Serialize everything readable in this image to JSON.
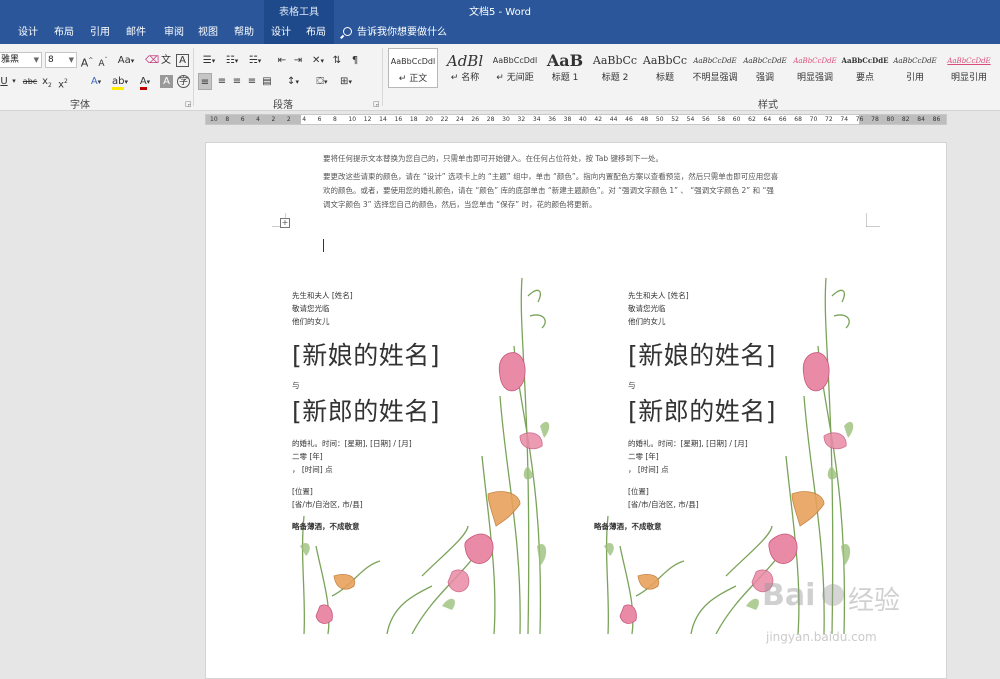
{
  "window": {
    "doc_title": "文档5 - Word",
    "context_group": "表格工具"
  },
  "tabs": [
    {
      "label": "设计"
    },
    {
      "label": "布局"
    },
    {
      "label": "引用"
    },
    {
      "label": "邮件"
    },
    {
      "label": "审阅"
    },
    {
      "label": "视图"
    },
    {
      "label": "帮助"
    },
    {
      "label": "设计"
    },
    {
      "label": "布局"
    }
  ],
  "tell_me": "告诉我你想要做什么",
  "font": {
    "name": "雅黑",
    "size": "8",
    "group_label": "字体"
  },
  "paragraph": {
    "group_label": "段落"
  },
  "styles": {
    "group_label": "样式",
    "items": [
      {
        "sample": "AaBbCcDdl",
        "name": "↵ 正文"
      },
      {
        "sample": "AdBl",
        "name": "↵ 名称"
      },
      {
        "sample": "AaBbCcDdl",
        "name": "↵ 无间距"
      },
      {
        "sample": "AaB",
        "name": "标题 1"
      },
      {
        "sample": "AaBbCc",
        "name": "标题 2"
      },
      {
        "sample": "AaBbCc",
        "name": "标题"
      },
      {
        "sample": "AaBbCcDdE",
        "name": "不明显强调"
      },
      {
        "sample": "AaBbCcDdE",
        "name": "强调"
      },
      {
        "sample": "AaBbCcDdE",
        "name": "明显强调"
      },
      {
        "sample": "AaBbCcDdE",
        "name": "要点"
      },
      {
        "sample": "AaBbCcDdE",
        "name": "引用"
      },
      {
        "sample": "AaBbCcDdE",
        "name": "明显引用"
      }
    ]
  },
  "ruler": {
    "numbers": [
      "10",
      "8",
      "6",
      "4",
      "2",
      "2",
      "4",
      "6",
      "8",
      "10",
      "12",
      "14",
      "16",
      "18",
      "20",
      "22",
      "24",
      "26",
      "28",
      "30",
      "32",
      "34",
      "36",
      "38",
      "40",
      "42",
      "44",
      "46",
      "48",
      "50",
      "52",
      "54",
      "56",
      "58",
      "60",
      "62",
      "64",
      "66",
      "68",
      "70",
      "72",
      "74",
      "76",
      "78",
      "80",
      "82",
      "84",
      "86"
    ]
  },
  "document": {
    "tip_lines": [
      "要将任何提示文本替换为您自己的，只需单击即可开始键入。在任何占位符处，按 Tab 键移到下一处。",
      "要更改这些请柬的颜色，请在 “设计” 选项卡上的 “主题” 组中，单击 “颜色”。指向内置配色方案以查看预览，然后只需单击即可应用您喜",
      "欢的颜色。或者，要使用您的婚礼颜色，请在 “颜色” 库的底部单击 “新建主题颜色”。对 “强调文字颜色 1” 、 “强调文字颜色 2” 和 “强",
      "调文字颜色 3” 选择您自己的颜色，然后，当您单击 “保存” 时，花的颜色将更新。"
    ],
    "cards": [
      {
        "host_line": "先生和夫人 [姓名]",
        "invite_line": "敬请您光临",
        "daughter_line": "他们的女儿",
        "bride": "[新娘的姓名]",
        "and": "与",
        "groom": "[新郎的姓名]",
        "date_line": "的婚礼。时间：[星期], [日期] / [月]",
        "year_line": "二零 [年]",
        "time_line": "， [时间] 点",
        "place_line": "[位置]",
        "city_line": "[省/市/自治区, 市/县]",
        "closing": "略备薄酒，不成敬意"
      },
      {
        "host_line": "先生和夫人 [姓名]",
        "invite_line": "敬请您光临",
        "daughter_line": "他们的女儿",
        "bride": "[新娘的姓名]",
        "and": "与",
        "groom": "[新郎的姓名]",
        "date_line": "的婚礼。时间：[星期], [日期] / [月]",
        "year_line": "二零 [年]",
        "time_line": "， [时间] 点",
        "place_line": "[位置]",
        "city_line": "[省/市/自治区, 市/县]",
        "closing": "略备薄酒，不成敬意"
      }
    ]
  },
  "watermark": {
    "brand": "Bai",
    "brand_cn": "经验",
    "url": "jingyan.baidu.com"
  },
  "colors": {
    "title_bar": "#2b579a",
    "ribbon": "#f3f3f3",
    "flower_pink": "#e98aa6",
    "flower_orange": "#e7a15c",
    "leaf_green": "#7aa35a"
  }
}
